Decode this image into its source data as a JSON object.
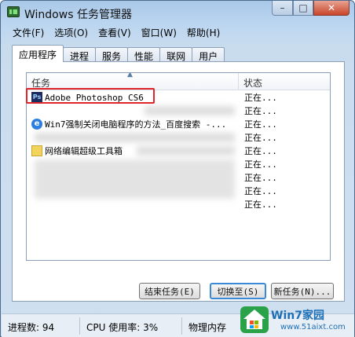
{
  "window": {
    "title": "Windows 任务管理器"
  },
  "title_buttons": {
    "minimize": "–",
    "maximize": "□",
    "close": "✕"
  },
  "menu": [
    {
      "label": "文件(F)"
    },
    {
      "label": "选项(O)"
    },
    {
      "label": "查看(V)"
    },
    {
      "label": "窗口(W)"
    },
    {
      "label": "帮助(H)"
    }
  ],
  "tabs": [
    {
      "label": "应用程序",
      "active": true
    },
    {
      "label": "进程"
    },
    {
      "label": "服务"
    },
    {
      "label": "性能"
    },
    {
      "label": "联网"
    },
    {
      "label": "用户"
    }
  ],
  "list": {
    "columns": {
      "task": "任务",
      "status": "状态"
    },
    "rows": [
      {
        "name": "Adobe Photoshop CS6",
        "status": "正在...",
        "icon": "photoshop-icon",
        "icon_text": "Ps"
      },
      {
        "name": "",
        "status": "正在...",
        "icon": ""
      },
      {
        "name": "Win7强制关闭电脑程序的方法_百度搜索 -...",
        "status": "正在...",
        "icon": "ie-icon",
        "icon_text": "e"
      },
      {
        "name": "",
        "status": "正在...",
        "icon": ""
      },
      {
        "name": "网络编辑超级工具箱",
        "status": "正在...",
        "icon": "folder-icon"
      },
      {
        "name": "",
        "status": "正在...",
        "icon": ""
      },
      {
        "name": "",
        "status": "正在...",
        "icon": ""
      },
      {
        "name": "",
        "status": "正在...",
        "icon": ""
      },
      {
        "name": "",
        "status": "正在...",
        "icon": ""
      }
    ]
  },
  "buttons": {
    "end_task": "结束任务(E)",
    "switch_to": "切换至(S)",
    "new_task": "新任务(N)..."
  },
  "statusbar": {
    "processes": "进程数: 94",
    "cpu": "CPU 使用率: 3%",
    "memory": "物理内存"
  },
  "watermark": {
    "brand": "Win7家园",
    "url": "www.51aixt.com"
  },
  "colors": {
    "highlight": "#e0262b",
    "accent": "#3a8ad8"
  }
}
